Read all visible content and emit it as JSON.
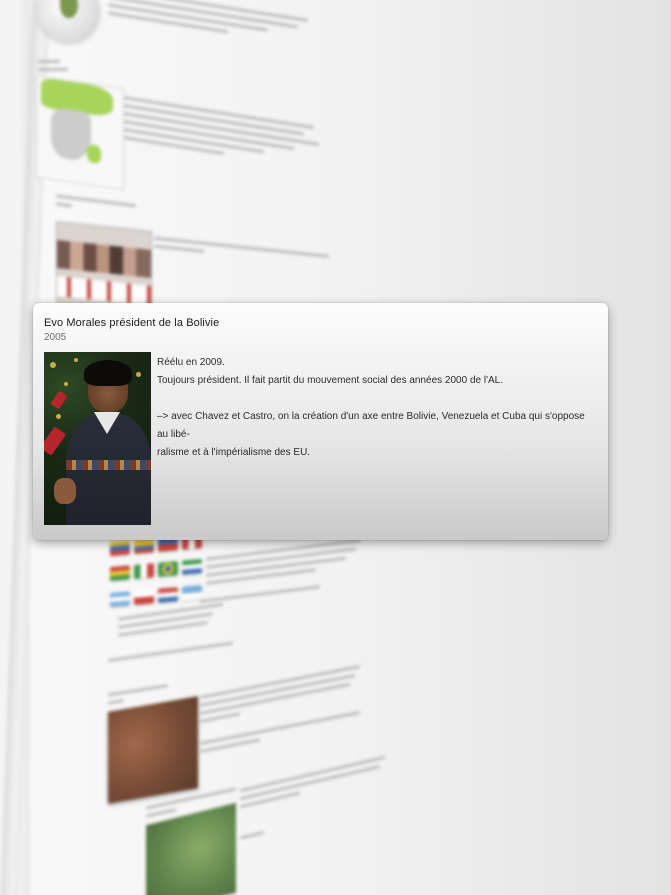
{
  "card": {
    "title": "Evo Morales président de la Bolivie",
    "date": "2005",
    "photo_subject": "Evo Morales portrait photo",
    "lines": [
      "Réélu en 2009.",
      "Toujours président. Il fait partit du mouvement social des années 2000 de l'AL.",
      "",
      "–> avec Chavez et Castro, on la création d'un axe entre Bolivie, Venezuela et Cuba qui s'oppose au libé-",
      "ralisme et à l'impérialisme des EU."
    ]
  },
  "colors": {
    "card_background_top": "#fdfdfd",
    "card_background_bottom": "#c9c9c9",
    "title_text": "#1a1a1a",
    "date_text": "#6b6b6b",
    "body_text": "#2b2b2b",
    "map_highlight": "#9fd24a"
  },
  "background_items": [
    {
      "name": "globe-thumbnail",
      "kind": "image"
    },
    {
      "name": "map-thumbnail",
      "kind": "image"
    },
    {
      "name": "faces-photo-thumbnail",
      "kind": "image"
    },
    {
      "name": "flags-thumbnail",
      "kind": "image"
    },
    {
      "name": "food-photo-thumbnail",
      "kind": "image"
    },
    {
      "name": "forest-photo-thumbnail",
      "kind": "image"
    }
  ]
}
